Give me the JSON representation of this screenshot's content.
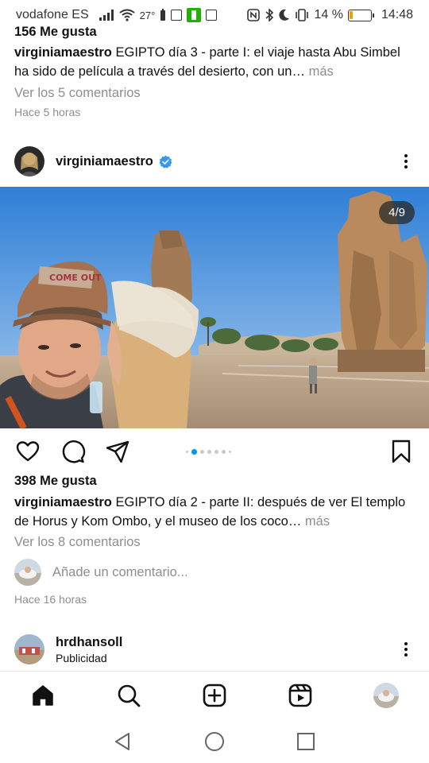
{
  "status": {
    "carrier": "vodafone ES",
    "temperature": "27°",
    "battery_pct": "14 %",
    "battery_level": 0.14,
    "time": "14:48"
  },
  "prev_post": {
    "likes": "156 Me gusta",
    "username": "virginiamaestro",
    "caption": "EGIPTO día 3 - parte I: el viaje hasta Abu Simbel ha sido de película a través del desierto, con un…",
    "more": " más",
    "comments": "Ver los 5 comentarios",
    "time": "Hace 5 horas"
  },
  "post": {
    "username": "virginiamaestro",
    "counter": "4/9",
    "likes": "398 Me gusta",
    "caption": "EGIPTO día 2 - parte II: después de ver El templo de Horus y Kom Ombo, y el museo de los coco…",
    "more": " más",
    "comments": "Ver los 8 comentarios",
    "add_comment_placeholder": "Añade un comentario...",
    "time": "Hace 16 horas",
    "slides_total": 9,
    "slide_current": 4
  },
  "ad": {
    "username": "hrdhansoll",
    "label": "Publicidad"
  },
  "colors": {
    "accent": "#0095f6",
    "verified": "#3897f0",
    "muted": "#8e8e8e"
  },
  "icons": {
    "like": "heart-icon",
    "comment": "comment-icon",
    "share": "send-icon",
    "save": "bookmark-icon",
    "nav": [
      "home-icon",
      "search-icon",
      "create-icon",
      "reels-icon",
      "profile-avatar"
    ],
    "system": [
      "back-icon",
      "home-circle-icon",
      "recents-icon"
    ]
  }
}
